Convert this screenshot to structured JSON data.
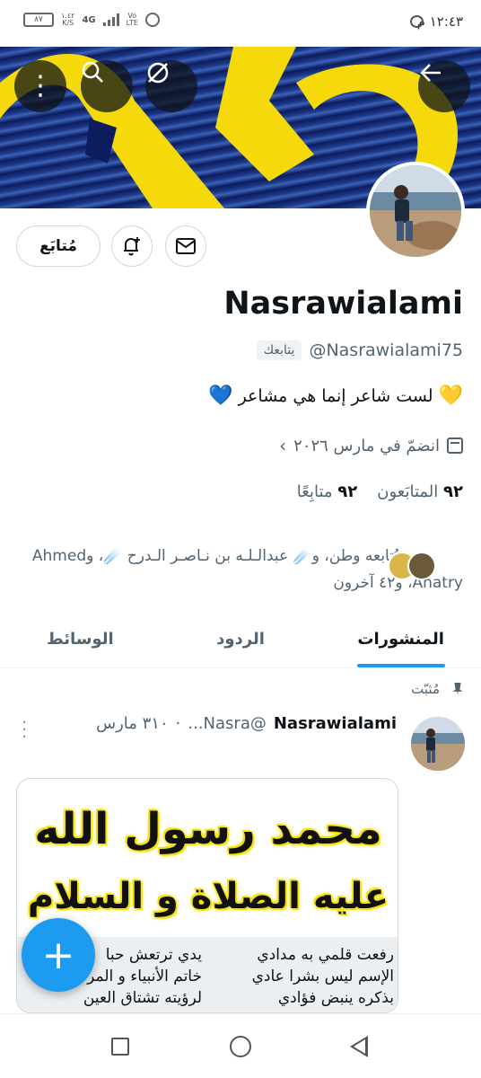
{
  "status_bar": {
    "time": "١٢:٤٣ م",
    "battery": "٨٧",
    "speed_value": "١.٤٢",
    "speed_unit": "K/S",
    "network": "4G",
    "volte_top": "Vo",
    "volte_bottom": "LTE"
  },
  "header": {
    "back_icon": "arrow-left-icon",
    "disable_icon": "circle-slash-icon",
    "search_icon": "search-icon",
    "more_icon": "vertical-dots-icon"
  },
  "profile": {
    "display_name": "Nasrawialami",
    "handle": "@Nasrawialami75",
    "follows_you": "يتابعك",
    "bio_text": "لست شاعر إنما هي مشاعر",
    "bio_emoji_start": "💛",
    "bio_emoji_end": "💙",
    "joined": "انضمّ في مارس ٢٠٢٦",
    "following_count": "٩٢",
    "following_label": "متابِعًا",
    "followers_count": "٩٢",
    "followers_label": "المتابَعون",
    "followed_by_text": "يُتابعه وطن، و☄️ عبدالـلـه بن نـاصـر الـدرح ☄️، وAhmed Anatry، و٤٢ آخرون",
    "follow_button": "مُتابَع",
    "accent_color": "#1d9bf0"
  },
  "tabs": [
    {
      "label": "المنشورات",
      "active": true
    },
    {
      "label": "الردود",
      "active": false
    },
    {
      "label": "الوسائط",
      "active": false
    }
  ],
  "post": {
    "pinned_label": "مُثبّت",
    "author_name": "Nasrawialami",
    "author_handle": "@Nasra...",
    "date": "٣١٠ مارس",
    "image_title_1": "محمد رسول الله",
    "image_title_2": "عليه الصلاة و السلام",
    "poem_right": [
      "رفعت قلمي به مدادي",
      "الإسم ليس بشرا عادي",
      "بذكره ينبض فؤادي"
    ],
    "poem_left": [
      "يدي ترتعش حبا",
      "خاتم الأنبياء و المرسلين",
      "لرؤيته تشتاق العين"
    ]
  },
  "fab": {
    "label": "+"
  }
}
